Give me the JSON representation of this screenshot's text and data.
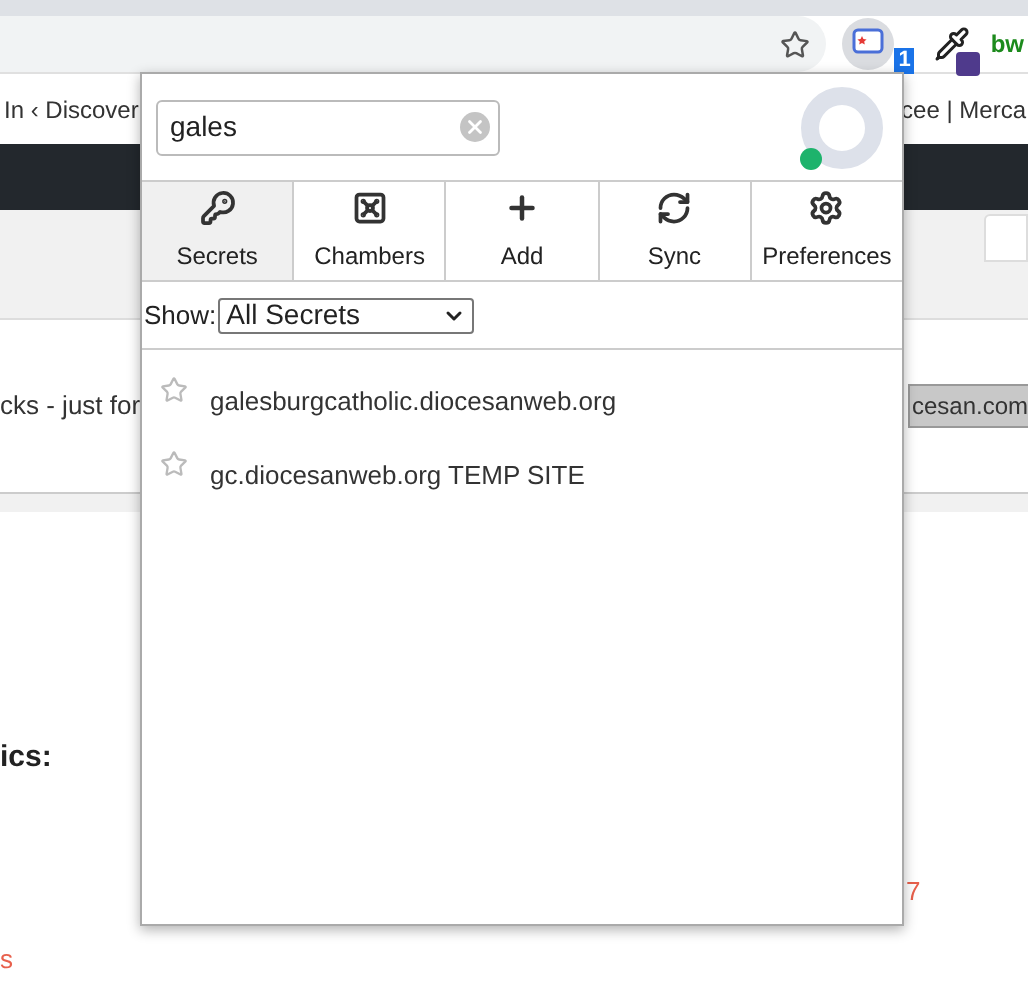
{
  "browser": {
    "bookmarks": [
      "In ‹ Discover",
      "cee | Merca"
    ],
    "extensions": [
      {
        "kind": "secrets",
        "badge": "1"
      },
      {
        "kind": "eyedropper"
      },
      {
        "kind": "text",
        "label": "bw"
      }
    ]
  },
  "page": {
    "left_text": "cks - just for",
    "field_value": "cesan.com",
    "heading": "ics:",
    "red_texts": [
      "7",
      "s"
    ]
  },
  "popup": {
    "search": {
      "value": "gales"
    },
    "user": {
      "online": true
    },
    "tabs": [
      {
        "label": "Secrets",
        "selected": true
      },
      {
        "label": "Chambers",
        "selected": false
      },
      {
        "label": "Add",
        "selected": false
      },
      {
        "label": "Sync",
        "selected": false
      },
      {
        "label": "Preferences",
        "selected": false
      }
    ],
    "filter": {
      "label": "Show:",
      "value": "All Secrets"
    },
    "items": [
      {
        "title": "galesburgcatholic.diocesanweb.org",
        "starred": false
      },
      {
        "title": "gc.diocesanweb.org TEMP SITE",
        "starred": false
      }
    ]
  }
}
